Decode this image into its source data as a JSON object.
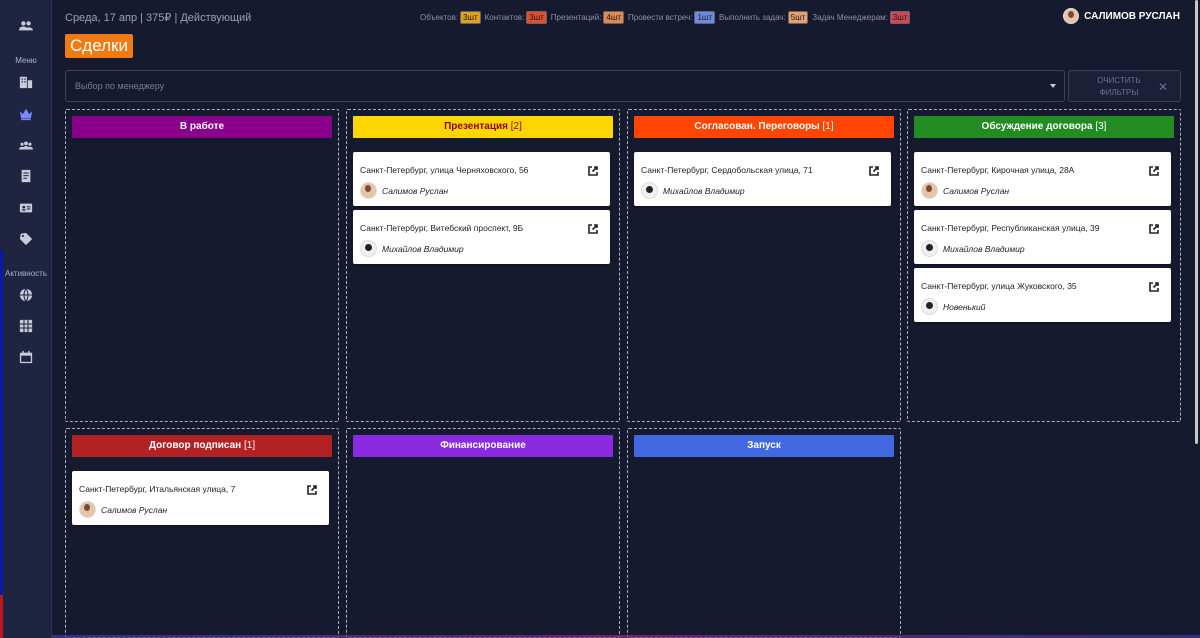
{
  "topbar": {
    "date_info": "Среда, 17 апр | 375₽ | Действующий",
    "stats": [
      {
        "label": "Объектов:",
        "value": "3шт",
        "color": "#e0a020"
      },
      {
        "label": "Контактов:",
        "value": "3шт",
        "color": "#e0502a"
      },
      {
        "label": "Презентаций:",
        "value": "4шт",
        "color": "#e08a50"
      },
      {
        "label": "Провести встреч:",
        "value": "1шт",
        "color": "#6a8ae8"
      },
      {
        "label": "Выполнить задач:",
        "value": "5шт",
        "color": "#e8a070"
      },
      {
        "label": "Задач Менеджерам:",
        "value": "3шт",
        "color": "#d04858"
      }
    ],
    "user_name": "САЛИМОВ РУСЛАН"
  },
  "sidebar": {
    "menu_label": "Меню",
    "activity_label": "Активность",
    "icons": [
      "people-icon",
      "building-icon",
      "crown-icon",
      "team-icon",
      "document-icon",
      "id-card-icon",
      "tag-icon",
      "globe-icon",
      "grid-icon",
      "calendar-icon"
    ]
  },
  "page": {
    "title": "Сделки",
    "filter_placeholder": "Выбор по менеджеру",
    "clear_filters": "ОЧИСТИТЬ ФИЛЬТРЫ",
    "accent": "#f07a14"
  },
  "columns": [
    {
      "title": "В работе",
      "count": "",
      "color": "#8b008b",
      "text_color": "#ffffff",
      "cards": []
    },
    {
      "title": "Презентация",
      "count": "[2]",
      "color": "#ffd700",
      "text_color": "#8b0000",
      "cards": [
        {
          "address": "Санкт-Петербург, улица Черняховского, 56",
          "manager": "Салимов Руслан",
          "avatar": "photo"
        },
        {
          "address": "Санкт-Петербург, Витебский проспект, 9Б",
          "manager": "Михайлов Владимир",
          "avatar": "silhouette"
        }
      ]
    },
    {
      "title": "Согласован. Переговоры",
      "count": "[1]",
      "color": "#ff4500",
      "text_color": "#ffffff",
      "cards": [
        {
          "address": "Санкт-Петербург, Сердобольская улица, 71",
          "manager": "Михайлов Владимир",
          "avatar": "silhouette"
        }
      ]
    },
    {
      "title": "Обсуждение договора",
      "count": "[3]",
      "color": "#228b22",
      "text_color": "#ffffff",
      "cards": [
        {
          "address": "Санкт-Петербург, Кирочная улица, 28А",
          "manager": "Салимов Руслан",
          "avatar": "photo"
        },
        {
          "address": "Санкт-Петербург, Республиканская улица, 39",
          "manager": "Михайлов Владимир",
          "avatar": "silhouette"
        },
        {
          "address": "Санкт-Петербург, улица Жуковского, 35",
          "manager": "Новенький",
          "avatar": "silhouette"
        }
      ]
    },
    {
      "title": "Договор подписан",
      "count": "[1]",
      "color": "#b22222",
      "text_color": "#ffffff",
      "cards": [
        {
          "address": "Санкт-Петербург, Итальянская улица, 7",
          "manager": "Салимов Руслан",
          "avatar": "photo"
        }
      ]
    },
    {
      "title": "Финансирование",
      "count": "",
      "color": "#8a2be2",
      "text_color": "#ffffff",
      "cards": []
    },
    {
      "title": "Запуск",
      "count": "",
      "color": "#4169e1",
      "text_color": "#ffffff",
      "cards": []
    }
  ]
}
